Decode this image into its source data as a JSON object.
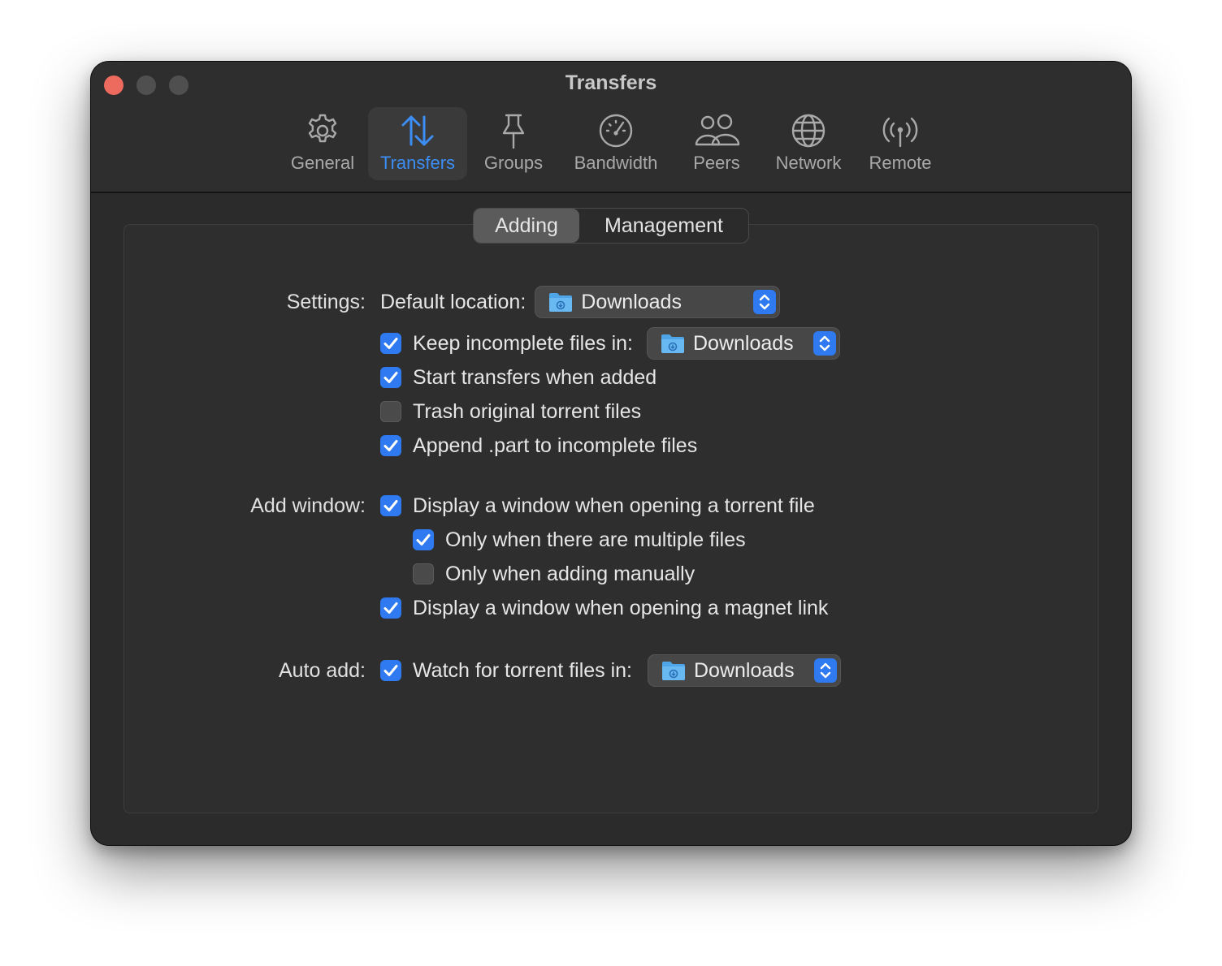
{
  "window": {
    "title": "Transfers"
  },
  "toolbar": {
    "items": [
      {
        "label": "General",
        "icon": "gear-icon"
      },
      {
        "label": "Transfers",
        "icon": "transfers-arrows-icon",
        "active": true
      },
      {
        "label": "Groups",
        "icon": "pin-icon"
      },
      {
        "label": "Bandwidth",
        "icon": "speedometer-icon"
      },
      {
        "label": "Peers",
        "icon": "peers-icon"
      },
      {
        "label": "Network",
        "icon": "globe-icon"
      },
      {
        "label": "Remote",
        "icon": "antenna-icon"
      }
    ]
  },
  "tabs": {
    "adding": "Adding",
    "management": "Management",
    "selected": "Adding"
  },
  "settings": {
    "label": "Settings:",
    "default_location_label": "Default location:",
    "default_location_value": "Downloads",
    "keep_incomplete": {
      "label": "Keep incomplete files in:",
      "checked": true,
      "value": "Downloads"
    },
    "start_when_added": {
      "label": "Start transfers when added",
      "checked": true
    },
    "trash_original": {
      "label": "Trash original torrent files",
      "checked": false
    },
    "append_part": {
      "label": "Append .part to incomplete files",
      "checked": true
    }
  },
  "add_window": {
    "label": "Add window:",
    "display_torrent": {
      "label": "Display a window when opening a torrent file",
      "checked": true
    },
    "only_multiple": {
      "label": "Only when there are multiple files",
      "checked": true
    },
    "only_manual": {
      "label": "Only when adding manually",
      "checked": false
    },
    "display_magnet": {
      "label": "Display a window when opening a magnet link",
      "checked": true
    }
  },
  "auto_add": {
    "label": "Auto add:",
    "watch": {
      "label": "Watch for torrent files in:",
      "checked": true,
      "value": "Downloads"
    }
  },
  "colors": {
    "accent": "#2f7af0",
    "active_tab_text": "#3c8ef5",
    "close_button": "#ed6a5e"
  }
}
